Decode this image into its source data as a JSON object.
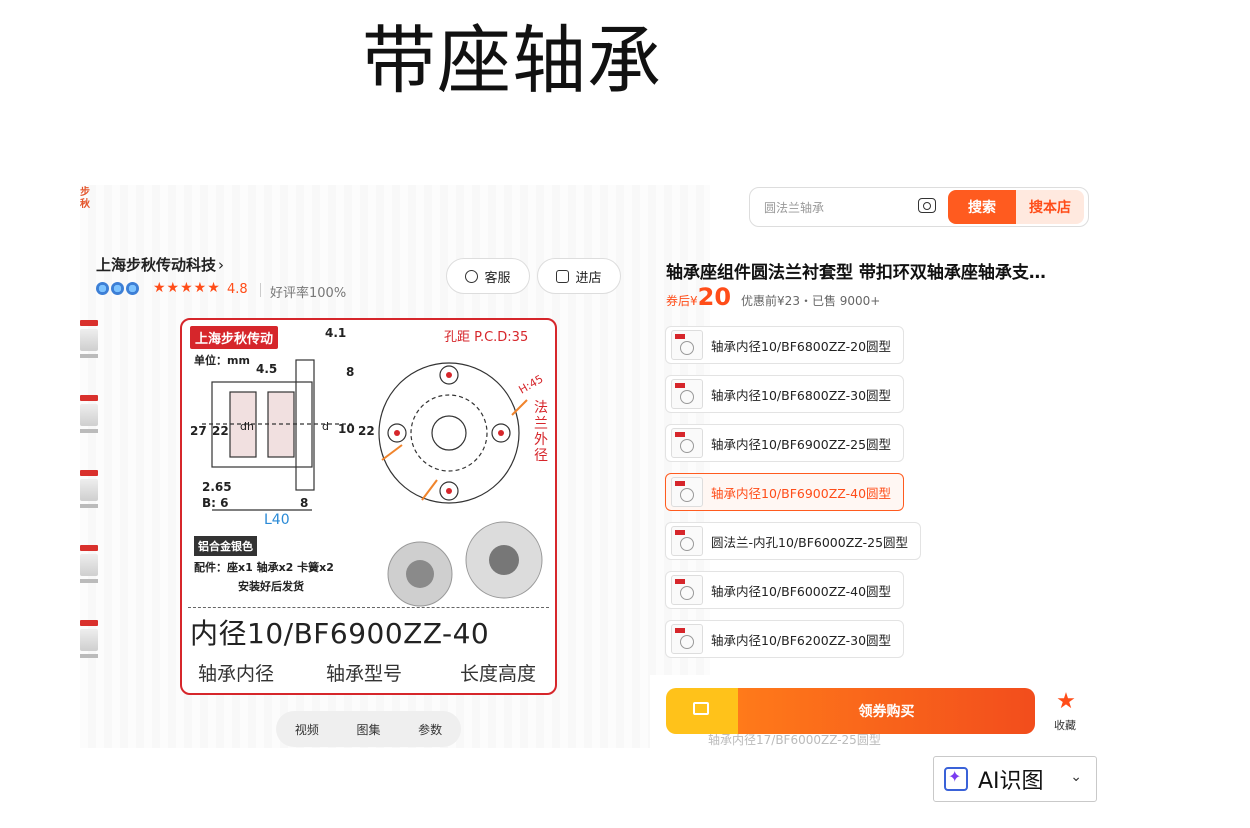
{
  "page": {
    "title": "带座轴承"
  },
  "store": {
    "brand_edge": "步秋",
    "name": "上海步秋传动科技",
    "chevron": "›",
    "rating": "4.8",
    "stars": "★★★★★",
    "good_rate": "好评率100%",
    "service_btn": "客服",
    "store_btn": "进店"
  },
  "product_image": {
    "brand_label": "上海步秋传动",
    "unit": "单位：mm",
    "pcd": "孔距 P.C.D:35",
    "h45": "H:45",
    "flange": "法兰外径",
    "dims": {
      "d1": "4.1",
      "d2": "4.5",
      "d3": "8",
      "d4": "27",
      "d5": "22",
      "d6": "dh",
      "d7": "d",
      "d8": "10",
      "d9": "22",
      "d10": "2.65",
      "d11": "B: 6",
      "d12": "8",
      "d13": "L40"
    },
    "material": "铝合金银色",
    "parts": "配件：座x1 轴承x2 卡簧x2",
    "shipping": "安装好后发货",
    "model": "内径10/BF6900ZZ-40",
    "legend_a": "轴承内径",
    "legend_b": "轴承型号",
    "legend_c": "长度高度"
  },
  "media_tabs": [
    "视频",
    "图集",
    "参数"
  ],
  "search": {
    "placeholder": "圆法兰轴承",
    "search_btn": "搜索",
    "shop_search_btn": "搜本店"
  },
  "product": {
    "title": "轴承座组件圆法兰衬套型 带扣环双轴承座轴承支…",
    "price_prefix": "券后¥",
    "price": "20",
    "price_meta": "优惠前¥23・已售 9000+"
  },
  "skus": [
    {
      "label": "轴承内径10/BF6800ZZ-20圆型",
      "selected": false
    },
    {
      "label": "轴承内径10/BF6800ZZ-30圆型",
      "selected": false
    },
    {
      "label": "轴承内径10/BF6900ZZ-25圆型",
      "selected": false
    },
    {
      "label": "轴承内径10/BF6900ZZ-40圆型",
      "selected": true
    },
    {
      "label": "圆法兰-内孔10/BF6000ZZ-25圆型",
      "selected": false
    },
    {
      "label": "轴承内径10/BF6000ZZ-40圆型",
      "selected": false
    },
    {
      "label": "轴承内径10/BF6200ZZ-30圆型",
      "selected": false
    }
  ],
  "ghost_sku": "轴承内径17/BF6000ZZ-25圆型",
  "buy": {
    "label": "领券购买",
    "fav": "收藏"
  },
  "ai": {
    "label": "AI识图",
    "chevron": "⌄"
  },
  "colors": {
    "accent": "#ff4d19",
    "brand_red": "#d6262b",
    "cart_yellow": "#ffc21a"
  }
}
